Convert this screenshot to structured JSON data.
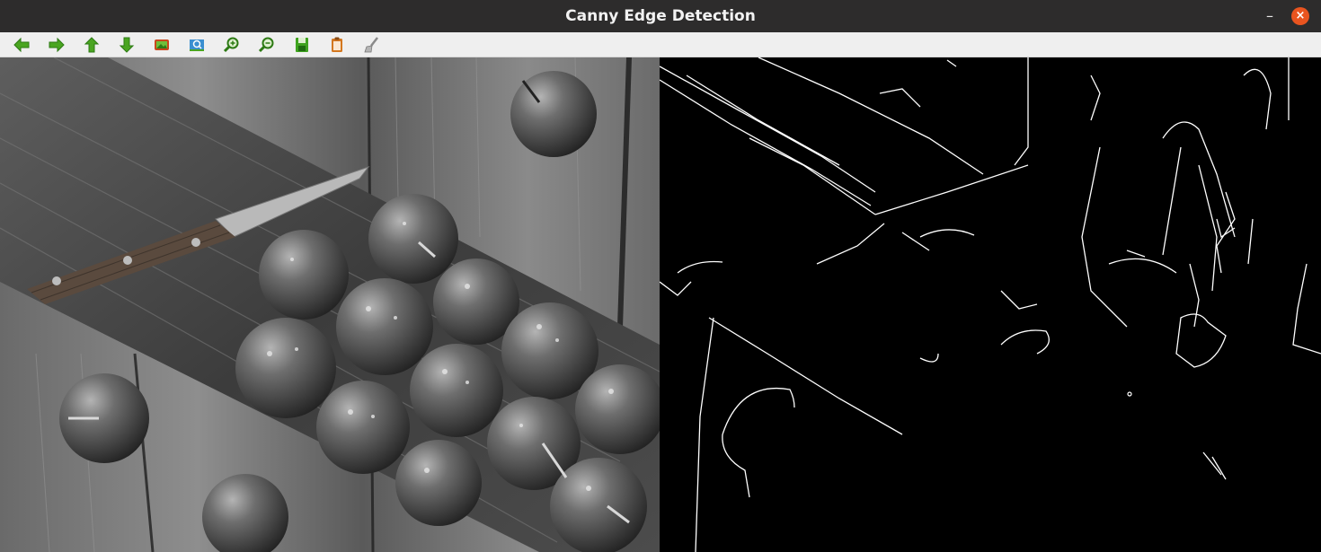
{
  "window": {
    "title": "Canny Edge Detection"
  },
  "toolbar": {
    "buttons": [
      {
        "name": "pan-left-button",
        "icon": "arrow-left-icon",
        "color": "#3fa31f"
      },
      {
        "name": "pan-right-button",
        "icon": "arrow-right-icon",
        "color": "#3fa31f"
      },
      {
        "name": "pan-up-button",
        "icon": "arrow-up-icon",
        "color": "#3fa31f"
      },
      {
        "name": "pan-down-button",
        "icon": "arrow-down-icon",
        "color": "#3fa31f"
      },
      {
        "name": "reset-view-button",
        "icon": "image-icon",
        "color": "#c8481c"
      },
      {
        "name": "zoom-fit-button",
        "icon": "zoom-fit-icon",
        "color": "#3fa31f"
      },
      {
        "name": "zoom-in-button",
        "icon": "zoom-in-icon",
        "color": "#3fa31f"
      },
      {
        "name": "zoom-out-button",
        "icon": "zoom-out-icon",
        "color": "#3fa31f"
      },
      {
        "name": "save-button",
        "icon": "floppy-icon",
        "color": "#3fa31f"
      },
      {
        "name": "copy-button",
        "icon": "clipboard-icon",
        "color": "#d3771f"
      },
      {
        "name": "properties-button",
        "icon": "brush-icon",
        "color": "#9a9a9a"
      }
    ]
  },
  "images": {
    "original": {
      "description_name": "grayscale-source-image"
    },
    "edges": {
      "description_name": "canny-edge-output-image"
    }
  }
}
